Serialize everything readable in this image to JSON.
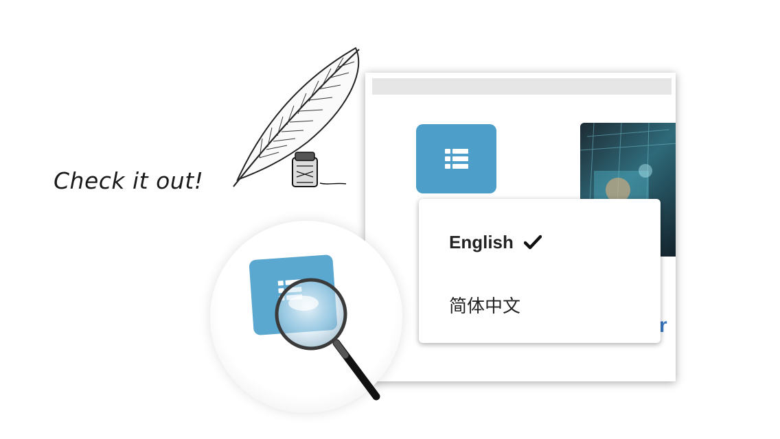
{
  "callout": {
    "text": "Check it out!"
  },
  "language_menu": {
    "button_icon": "list-icon",
    "selected_item": "English",
    "selected_check_icon": "check-icon",
    "items": [
      "English",
      "简体中文"
    ]
  },
  "colors": {
    "button": "#4d9fc9",
    "menu_text": "#222222",
    "link_blue": "#3a78c2"
  }
}
